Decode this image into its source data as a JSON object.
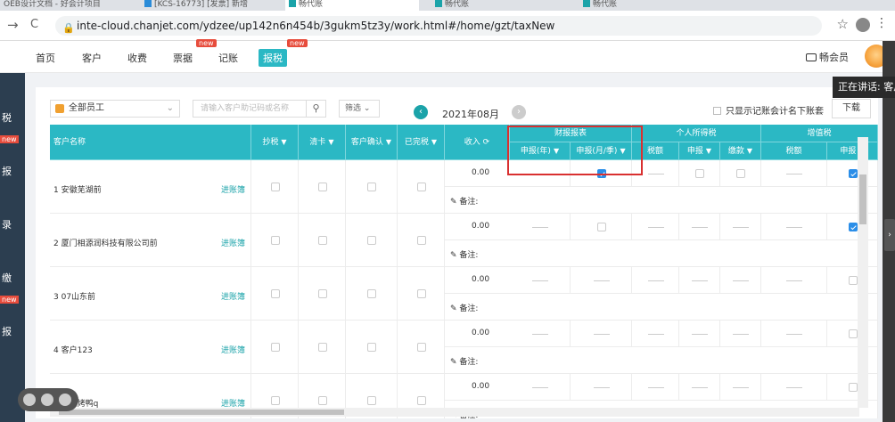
{
  "browser": {
    "tabs": [
      "OEB设计文档 - 好会计项目",
      "[KCS-16773] [发票] 新增",
      "畅代账",
      "畅代账",
      "畅代账"
    ],
    "url": "inte-cloud.chanjet.com/ydzee/up142n6n454b/3gukm5tz3y/work.html#/home/gzt/taxNew",
    "back": "→",
    "reload": "C"
  },
  "sidebar": {
    "items": [
      "税",
      "报",
      "录",
      "缴",
      "报"
    ],
    "new_badges": [
      "new",
      "new"
    ]
  },
  "nav": {
    "items": [
      "首页",
      "客户",
      "收费",
      "票据",
      "记账",
      "报税"
    ],
    "new_badge": "new",
    "member": "畅会员"
  },
  "toolbar": {
    "employee_select": "全部员工",
    "search_placeholder": "请输入客户助记码或名称",
    "filter": "筛选",
    "month": "2021年08月",
    "only_show": "只显示记账会计名下账套",
    "download": "下载"
  },
  "table": {
    "headers": {
      "customer": "客户名称",
      "copy_tax": "抄税",
      "clear_card": "清卡",
      "customer_confirm": "客户确认",
      "filed": "已完税",
      "income": "收入",
      "group_finance": "财报报表",
      "declare_year": "申报(年)",
      "declare_month": "申报(月/季)",
      "group_personal": "个人所得税",
      "tax_amount": "税额",
      "declare": "申报",
      "pay": "缴款",
      "group_vat": "增值税",
      "vat_tax_amount": "税额",
      "vat_declare": "申报"
    },
    "ledger_link": "进账簿",
    "note_label": "备注:",
    "rows": [
      {
        "name": "1 安徽芜湖前",
        "income": "0.00"
      },
      {
        "name": "2 厦门相源润科技有限公司前",
        "income": "0.00"
      },
      {
        "name": "3 07山东前",
        "income": "0.00"
      },
      {
        "name": "4 客户123",
        "income": "0.00"
      },
      {
        "name": "5 北京烤鸭q",
        "income": "0.00"
      }
    ]
  },
  "overlay": {
    "speaking": "正在讲话: 客户"
  }
}
